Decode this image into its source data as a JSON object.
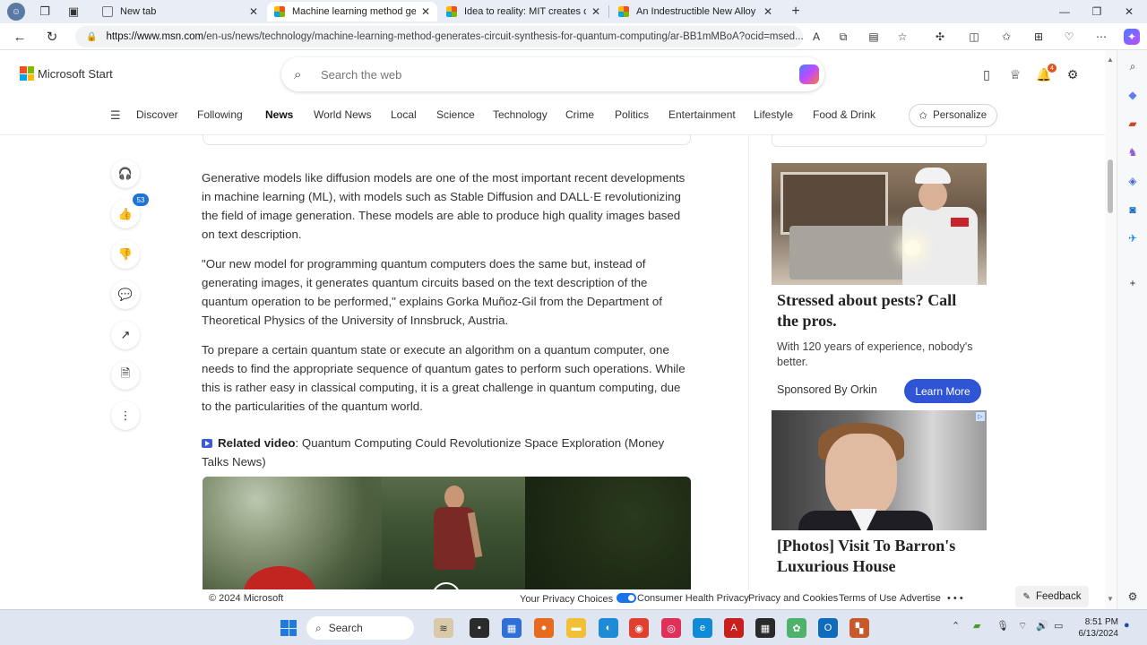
{
  "browser": {
    "tabs": [
      {
        "label": "New tab",
        "active": false
      },
      {
        "label": "Machine learning method generates",
        "active": true
      },
      {
        "label": "Idea to reality: MIT creates coin-si",
        "active": false
      },
      {
        "label": "An Indestructible New Alloy Is Dé",
        "active": false
      }
    ],
    "url_host": "https://www.msn.com",
    "url_path": "/en-us/news/technology/machine-learning-method-generates-circuit-synthesis-for-quantum-computing/ar-BB1mMBoA?ocid=msed..."
  },
  "header": {
    "logo_text": "Microsoft Start",
    "search_placeholder": "Search the web",
    "notification_count": "4"
  },
  "nav": {
    "categories": [
      "Discover",
      "Following",
      "News",
      "World News",
      "Local",
      "Science",
      "Technology",
      "Crime",
      "Politics",
      "Entertainment",
      "Lifestyle",
      "Food & Drink"
    ],
    "active": "News",
    "personalize_label": "Personalize"
  },
  "actions": {
    "like_count": "53"
  },
  "article": {
    "paragraphs": [
      "Generative models like diffusion models are one of the most important recent developments in machine learning (ML), with models such as Stable Diffusion and DALL·E revolutionizing the field of image generation. These models are able to produce high quality images based on text description.",
      "\"Our new model for programming quantum computers does the same but, instead of generating images, it generates quantum circuits based on the text description of the quantum operation to be performed,\" explains Gorka Muñoz-Gil from the Department of Theoretical Physics of the University of Innsbruck, Austria.",
      "To prepare a certain quantum state or execute an algorithm on a quantum computer, one needs to find the appropriate sequence of quantum gates to perform such operations. While this is rather easy in classical computing, it is a great challenge in quantum computing, due to the particularities of the quantum world."
    ],
    "related_label": "Related video",
    "related_text": ": Quantum Computing Could Revolutionize Space Exploration (Money Talks News)"
  },
  "ads": {
    "ad1": {
      "title": "Stressed about pests? Call the pros.",
      "body": "With 120 years of experience, nobody's better.",
      "sponsor": "Sponsored By Orkin",
      "cta": "Learn More"
    },
    "ad2": {
      "title": "[Photos] Visit To Barron's Luxurious House"
    }
  },
  "footer": {
    "copyright": "© 2024 Microsoft",
    "links": [
      "Your Privacy Choices",
      "Consumer Health Privacy",
      "Privacy and Cookies",
      "Terms of Use",
      "Advertise"
    ],
    "feedback": "Feedback"
  },
  "taskbar": {
    "search_label": "Search",
    "time": "8:51 PM",
    "date": "6/13/2024"
  },
  "colors": {
    "accent": "#2f55d4",
    "badge_blue": "#1f74d6",
    "notification": "#e2541c",
    "taskbar": "#dfe6f2"
  }
}
